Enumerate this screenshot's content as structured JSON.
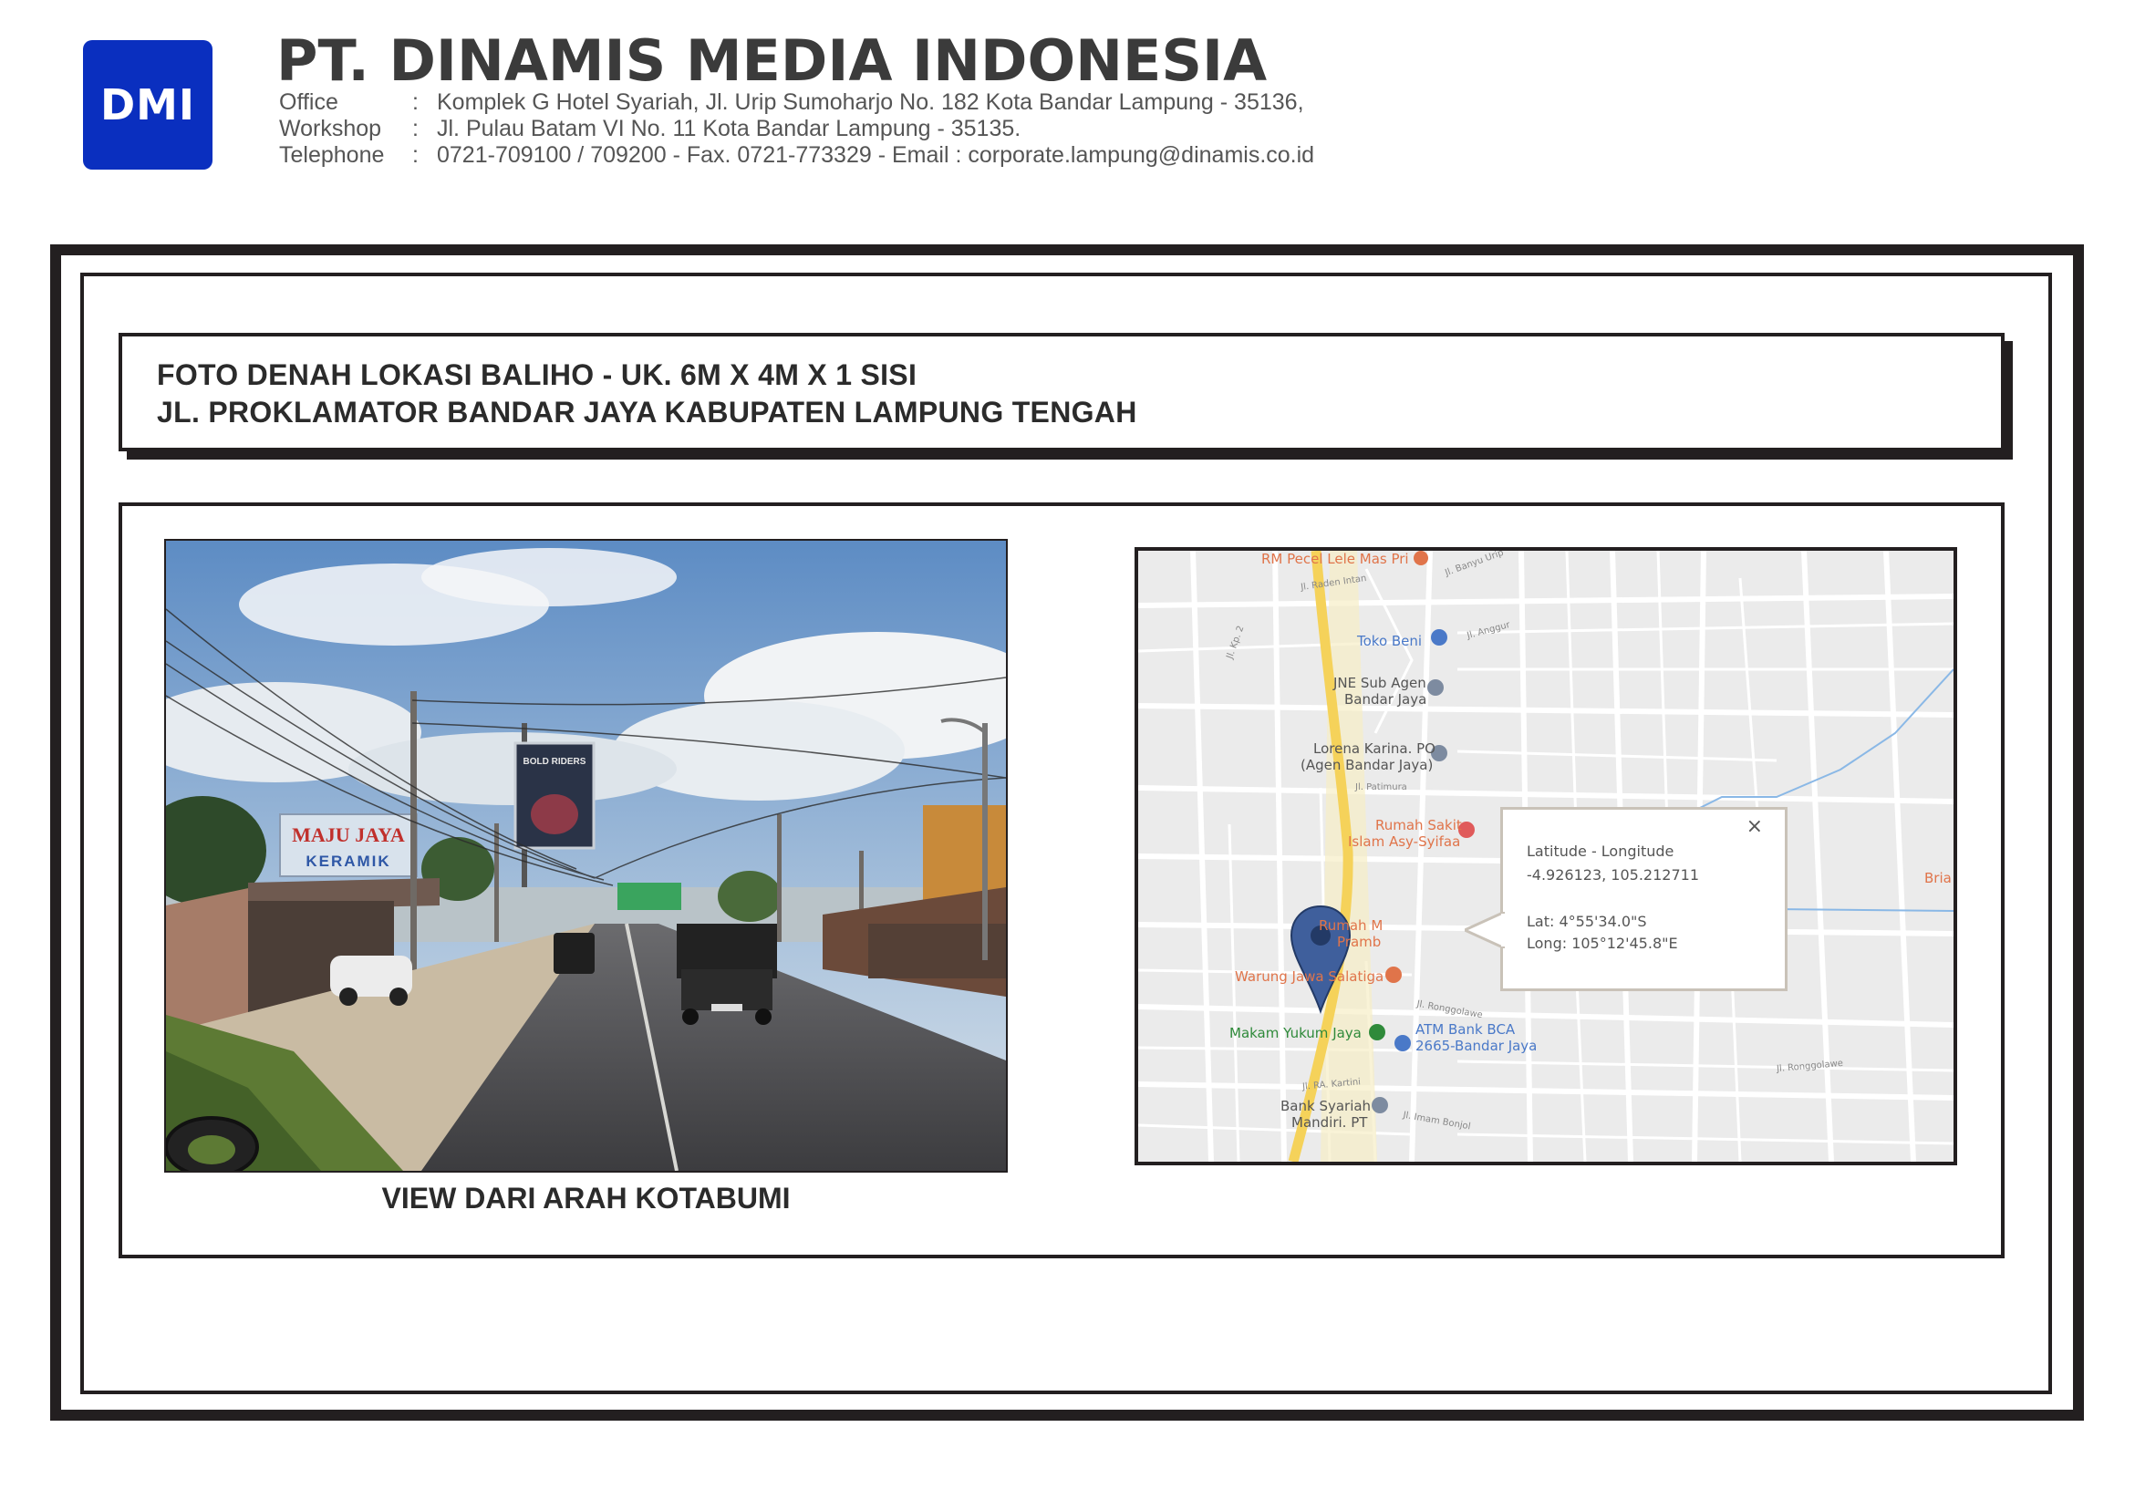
{
  "header": {
    "logo_text": "DMI",
    "company_name": "PT. DINAMIS MEDIA INDONESIA",
    "rows": [
      {
        "label": "Office",
        "sep": ":",
        "value": "Komplek G Hotel Syariah, Jl. Urip  Sumoharjo No. 182 Kota Bandar Lampung - 35136,"
      },
      {
        "label": "Workshop",
        "sep": ":",
        "value": "Jl. Pulau Batam  VI  No. 11 Kota Bandar Lampung - 35135."
      },
      {
        "label": "Telephone",
        "sep": ":",
        "value": "0721-709100 / 709200 - Fax. 0721-773329 - Email : corporate.lampung@dinamis.co.id"
      }
    ]
  },
  "title": {
    "line1": "FOTO DENAH LOKASI BALIHO - UK. 6M X 4M X 1 SISI",
    "line2": "JL. PROKLAMATOR BANDAR JAYA KABUPATEN LAMPUNG TENGAH"
  },
  "photo": {
    "caption": "VIEW DARI ARAH KOTABUMI",
    "shop_sign_line1": "MAJU JAYA",
    "shop_sign_line2": "KERAMIK",
    "billboard_text": "BOLD RIDERS"
  },
  "map": {
    "places": [
      {
        "name": "RM Pecel Lele Mas Pri",
        "color": "#e0744a"
      },
      {
        "name": "Toko Beni",
        "color": "#4a79c8"
      },
      {
        "name": "JNE Sub Agen",
        "color": "#555555"
      },
      {
        "name": "Bandar Jaya",
        "color": "#555555"
      },
      {
        "name": "Lorena Karina. PO",
        "color": "#555555"
      },
      {
        "name": "(Agen Bandar Jaya)",
        "color": "#555555"
      },
      {
        "name": "Rumah Sakit",
        "color": "#e0744a"
      },
      {
        "name": "Islam Asy-Syifaa",
        "color": "#e0744a"
      },
      {
        "name": "Rumah M",
        "color": "#e0744a"
      },
      {
        "name": "Pramb",
        "color": "#e0744a"
      },
      {
        "name": "Warung Jawa Salatiga",
        "color": "#e0744a"
      },
      {
        "name": "Makam Yukum Jaya",
        "color": "#2f8a3a"
      },
      {
        "name": "ATM Bank BCA",
        "color": "#4a79c8"
      },
      {
        "name": "2665-Bandar Jaya",
        "color": "#4a79c8"
      },
      {
        "name": "Bank Syariah",
        "color": "#555555"
      },
      {
        "name": "Mandiri. PT",
        "color": "#555555"
      },
      {
        "name": "Bria",
        "color": "#e0744a"
      }
    ],
    "streets": [
      "Jl. Raden Intan",
      "Jl. Banyu Urip",
      "Jl. Kp. 2",
      "Jl. Anggur",
      "Jl. Patimura",
      "Jl. Ronggolawe",
      "Jl. RA. Kartini",
      "Jl. Imam Bonjol",
      "Jl. Ronggolawe"
    ],
    "popup": {
      "heading": "Latitude - Longitude",
      "decimal": "-4.926123, 105.212711",
      "lat": "Lat: 4°55'34.0\"S",
      "long": "Long: 105°12'45.8\"E",
      "close": "×"
    },
    "road_color": "#f5d25a",
    "pin_color": "#3f5f9c"
  }
}
